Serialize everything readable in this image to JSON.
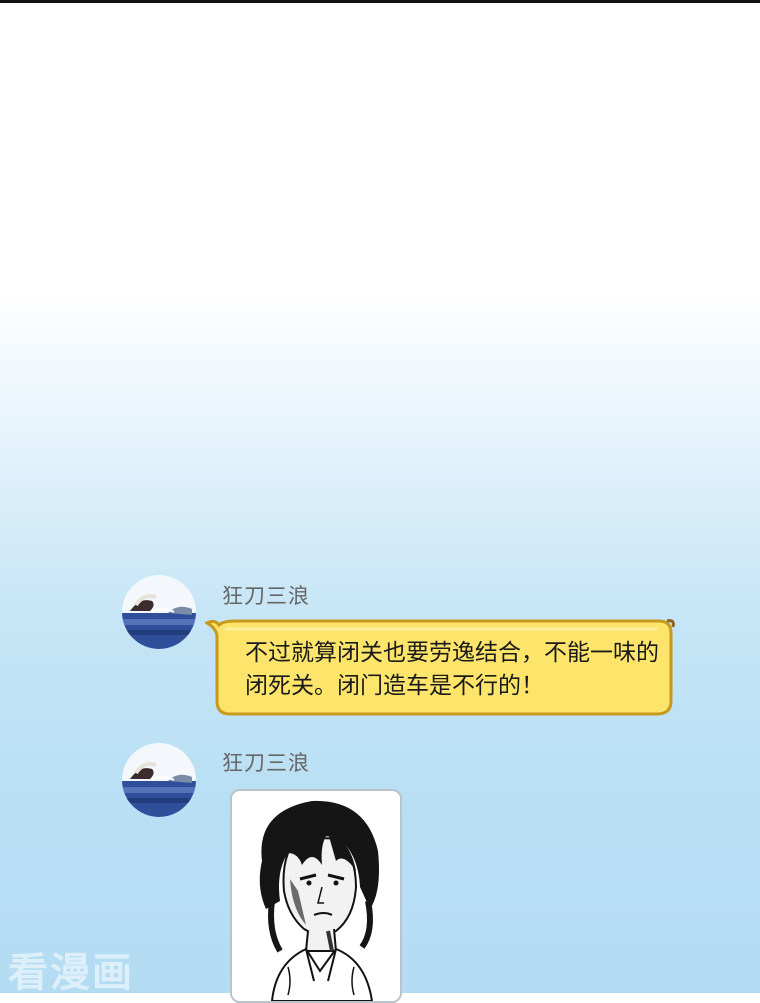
{
  "chat": {
    "messages": [
      {
        "sender": "狂刀三浪",
        "avatar_icon": "avatar-seascape-icon",
        "type": "text",
        "text": "不过就算闭关也要劳逸结合，不能一味的闭死关。闭门造车是不行的！"
      },
      {
        "sender": "狂刀三浪",
        "avatar_icon": "avatar-seascape-icon",
        "type": "image",
        "image_icon": "manga-character-sketch-icon"
      }
    ]
  },
  "watermark": "看漫画",
  "colors": {
    "bubble_fill": "#fde56b",
    "bubble_border": "#c79a1e",
    "background_bottom": "#b3dcf3"
  }
}
